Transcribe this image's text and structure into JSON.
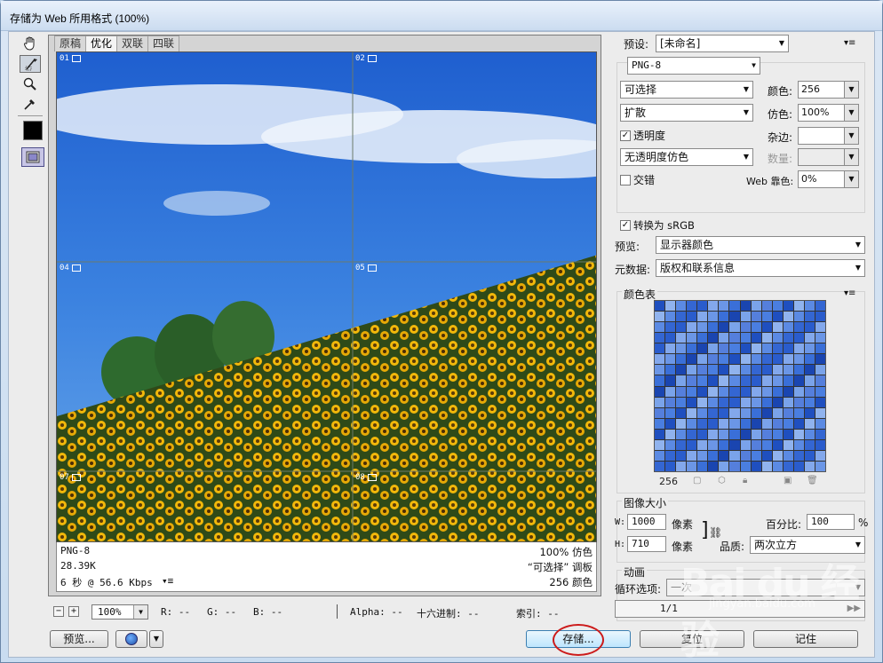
{
  "window": {
    "title": "存储为 Web 所用格式 (100%)"
  },
  "tabs": [
    {
      "label": "原稿",
      "active": false
    },
    {
      "label": "优化",
      "active": true
    },
    {
      "label": "双联",
      "active": false
    },
    {
      "label": "四联",
      "active": false
    }
  ],
  "slices": [
    "01",
    "02",
    "04",
    "05",
    "07",
    "08"
  ],
  "info": {
    "format": "PNG-8",
    "size": "28.39K",
    "time": "6 秒 @ 56.6 Kbps",
    "dither": "100% 仿色",
    "palette": "“可选择” 调板",
    "colors": "256 颜色"
  },
  "statusbar": {
    "zoom": "100%",
    "r": "R: --",
    "g": "G: --",
    "b": "B: --",
    "alpha": "Alpha: --",
    "hex": "十六进制: --",
    "index": "索引: --"
  },
  "settings": {
    "preset_label": "预设:",
    "preset_value": "[未命名]",
    "format": "PNG-8",
    "reduction": "可选择",
    "colors_label": "颜色:",
    "colors_value": "256",
    "dither_algo": "扩散",
    "dither_label": "仿色:",
    "dither_value": "100%",
    "transparency_label": "透明度",
    "transparency_checked": true,
    "matte_label": "杂边:",
    "matte_value": "",
    "trans_dither": "无透明度仿色",
    "amount_label": "数量:",
    "interlaced_label": "交错",
    "interlaced_checked": false,
    "websnap_label": "Web 靠色:",
    "websnap_value": "0%",
    "srgb_label": "转换为 sRGB",
    "srgb_checked": true,
    "preview_label": "预览:",
    "preview_value": "显示器颜色",
    "metadata_label": "元数据:",
    "metadata_value": "版权和联系信息"
  },
  "color_table": {
    "title": "颜色表",
    "count": "256",
    "colors": [
      "#1f4fbf",
      "#3a6fd8",
      "#5b8ae3",
      "#7aa3ea",
      "#2a5ccc",
      "#4a7ee0",
      "#6b96e6",
      "#90b3ee",
      "#1a45b0",
      "#3466d2",
      "#557fdc",
      "#83a8ec"
    ]
  },
  "image_size": {
    "title": "图像大小",
    "w_label": "W:",
    "w_value": "1000",
    "h_label": "H:",
    "h_value": "710",
    "unit": "像素",
    "percent_label": "百分比:",
    "percent_value": "100",
    "percent_unit": "%",
    "quality_label": "品质:",
    "quality_value": "两次立方"
  },
  "animation": {
    "title": "动画",
    "loop_label": "循环选项:",
    "loop_value": "一次",
    "frame": "1/1"
  },
  "buttons": {
    "preview": "预览...",
    "save": "存储...",
    "reset": "复位",
    "remember": "记住"
  },
  "watermark": {
    "main": "Bai du 经验",
    "sub": "jingyan.baidu.com"
  }
}
